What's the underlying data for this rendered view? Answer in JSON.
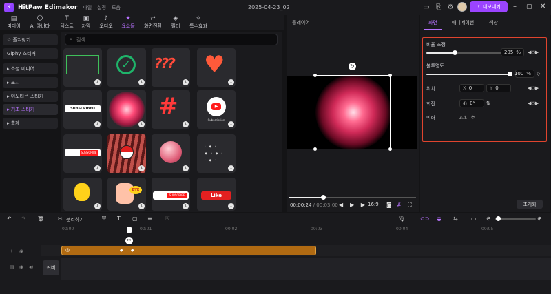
{
  "app": {
    "name": "HitPaw Edimakor",
    "menus": [
      "파일",
      "설정",
      "도움"
    ],
    "doc_title": "2025-04-23_02",
    "export_label": "내보내기",
    "accent": "#9b44ff"
  },
  "toolbar": {
    "items": [
      {
        "label": "미디어",
        "icon": "media-icon"
      },
      {
        "label": "AI 아바타",
        "icon": "avatar-icon"
      },
      {
        "label": "텍스트",
        "icon": "text-icon"
      },
      {
        "label": "자막",
        "icon": "subtitle-icon"
      },
      {
        "label": "오디오",
        "icon": "audio-icon"
      },
      {
        "label": "요소들",
        "icon": "elements-icon",
        "active": true
      },
      {
        "label": "화면전환",
        "icon": "transition-icon"
      },
      {
        "label": "필터",
        "icon": "filter-icon"
      },
      {
        "label": "특수효과",
        "icon": "effects-icon"
      }
    ]
  },
  "sidebar": {
    "items": [
      {
        "label": "☆ 즐겨찾기"
      },
      {
        "label": "Giphy 스티커"
      },
      {
        "label": "▸ 소셜 미디어"
      },
      {
        "label": "▸ 표지"
      },
      {
        "label": "▸ 이모티콘 스티커"
      },
      {
        "label": "▸ 기초 스티커",
        "active": true
      },
      {
        "label": "▸ 축제"
      }
    ]
  },
  "search": {
    "placeholder": "검색"
  },
  "stickers": {
    "tiles": [
      {
        "name": "green-frame"
      },
      {
        "name": "green-check"
      },
      {
        "name": "question-marks"
      },
      {
        "name": "heart-face"
      },
      {
        "name": "subscribed-button",
        "text": "SUBSCRIBED"
      },
      {
        "name": "pink-burst"
      },
      {
        "name": "red-hashtag"
      },
      {
        "name": "youtube-subscription",
        "text": "Subscription"
      },
      {
        "name": "subscribe-bar",
        "text": "SUBSCRIBE"
      },
      {
        "name": "pokeball-rays"
      },
      {
        "name": "pink-orb"
      },
      {
        "name": "sparkle-dots"
      },
      {
        "name": "yellow-bomb"
      },
      {
        "name": "bye-hand",
        "text": "BYE"
      },
      {
        "name": "red-subscribe",
        "text": "SUBSCRIBE"
      },
      {
        "name": "like-button",
        "text": "Like"
      }
    ]
  },
  "preview": {
    "title": "플레이어",
    "current_time": "00:00:24",
    "total_time": "00:03:00",
    "ratio": "16:9",
    "progress": 0.26
  },
  "properties": {
    "tabs": [
      "화면",
      "애니메이션",
      "색상"
    ],
    "active_tab": "화면",
    "scale": {
      "label": "비율 조정",
      "value": "205",
      "unit": "%",
      "level": 0.2
    },
    "opacity": {
      "label": "불투명도",
      "value": "100",
      "unit": "%",
      "level": 1.0
    },
    "position": {
      "label": "위치",
      "x_label": "X",
      "x": "0",
      "y_label": "Y",
      "y": "0"
    },
    "rotation": {
      "label": "회전",
      "value": "0°"
    },
    "mirror": {
      "label": "미러"
    },
    "reset_label": "초기화"
  },
  "timeline": {
    "tools": {
      "split_label": "분리하기"
    },
    "ruler": [
      "00:00",
      "00:01",
      "00:02",
      "00:03",
      "00:04",
      "00:05"
    ],
    "cover_label": "커버"
  }
}
